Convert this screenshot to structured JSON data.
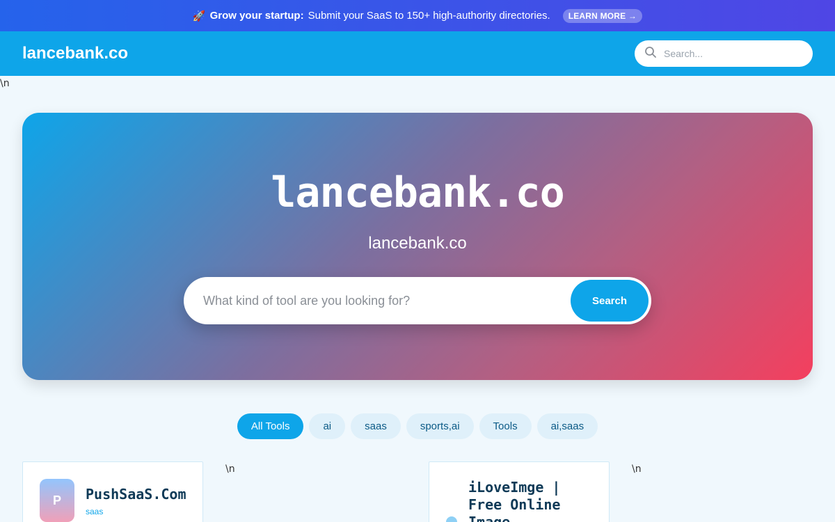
{
  "promo": {
    "rocket": "🚀",
    "bold": "Grow your startup:",
    "text": "Submit your SaaS to 150+ high-authority directories.",
    "cta": "LEARN MORE →"
  },
  "nav": {
    "brand": "lancebank.co",
    "search_placeholder": "Search..."
  },
  "stray_text": "\\n",
  "hero": {
    "title": "lancebank.co",
    "subtitle": "lancebank.co",
    "search_placeholder": "What kind of tool are you looking for?",
    "search_button": "Search"
  },
  "filters": [
    "All Tools",
    "ai",
    "saas",
    "sports,ai",
    "Tools",
    "ai,saas"
  ],
  "cards": [
    {
      "initial": "P",
      "title": "PushSaaS.Com",
      "tag": "saas"
    },
    {
      "title_lines": [
        "iLoveImge |",
        "Free Online",
        "Image"
      ]
    }
  ],
  "colors": {
    "promo_bg": "#3b5bea",
    "nav_bg": "#0ea5e9",
    "accent": "#0ea5e9",
    "hero_gradient_end": "#f43f5e"
  }
}
